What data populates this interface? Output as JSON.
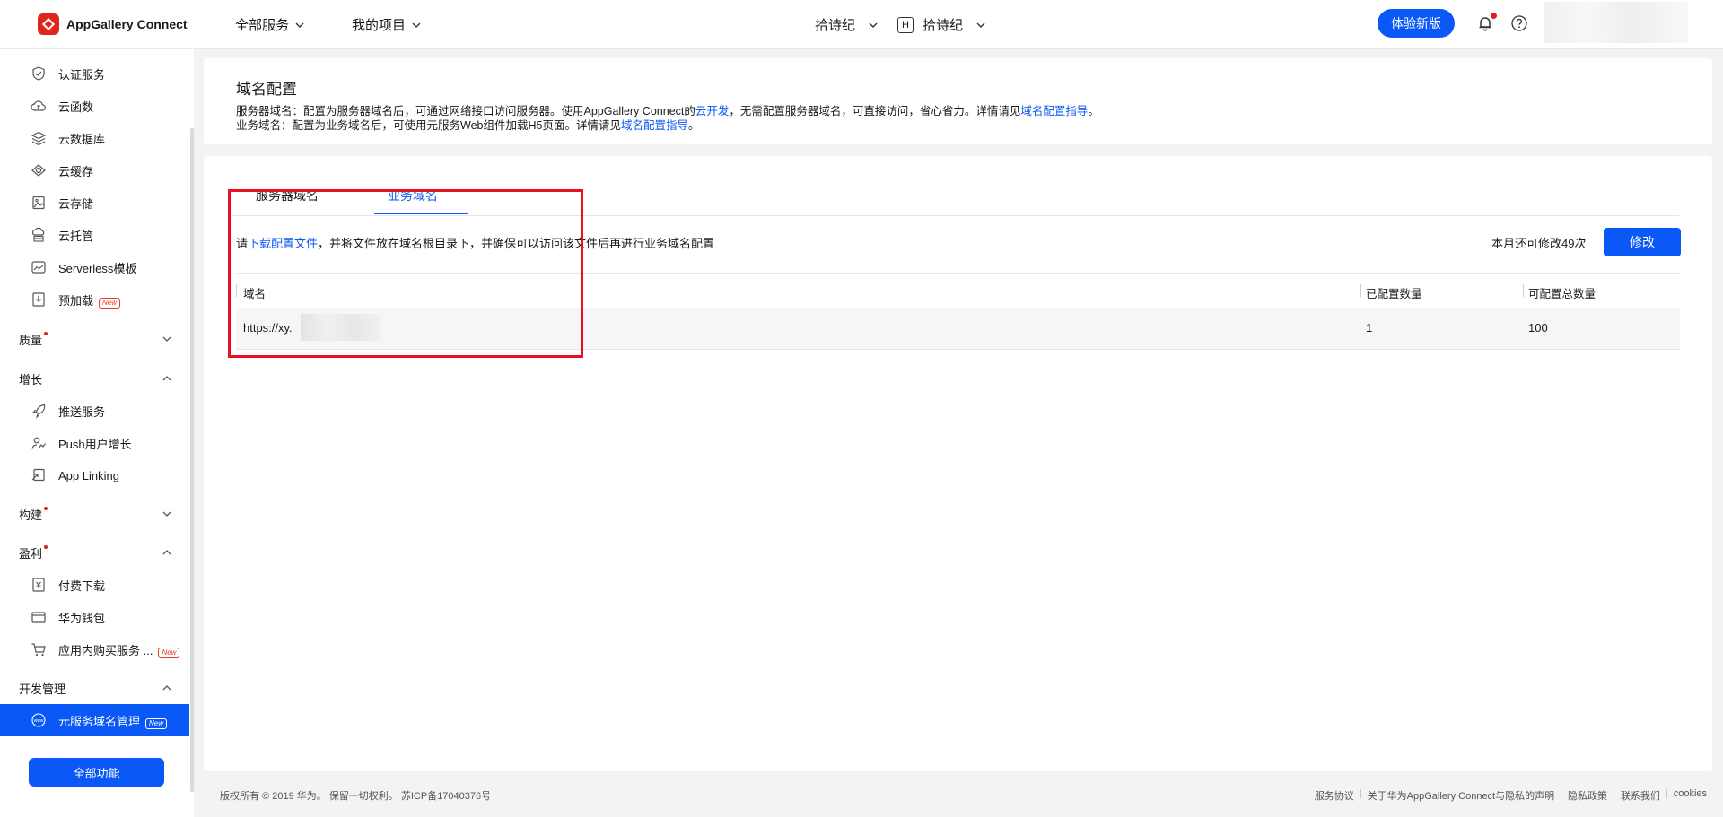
{
  "topbar": {
    "brand": "AppGallery Connect",
    "all_services": "全部服务",
    "my_projects": "我的项目",
    "project_selector": "拾诗纪",
    "app_badge": "H",
    "app_selector": "拾诗纪",
    "try_new_button": "体验新版"
  },
  "sidebar": {
    "items_top": [
      {
        "label": "认证服务",
        "icon": "shield-check-icon"
      },
      {
        "label": "云函数",
        "icon": "cloud-function-icon"
      },
      {
        "label": "云数据库",
        "icon": "database-icon"
      },
      {
        "label": "云缓存",
        "icon": "cloud-cache-icon"
      },
      {
        "label": "云存储",
        "icon": "image-storage-icon"
      },
      {
        "label": "云托管",
        "icon": "cloud-hosting-icon"
      },
      {
        "label": "Serverless模板",
        "icon": "template-icon"
      },
      {
        "label": "预加载",
        "icon": "preload-icon",
        "badge": "New"
      }
    ],
    "group_quality": "质量",
    "group_growth": "增长",
    "growth_items": [
      {
        "label": "推送服务",
        "icon": "rocket-icon"
      },
      {
        "label": "Push用户增长",
        "icon": "user-growth-icon"
      },
      {
        "label": "App Linking",
        "icon": "link-icon"
      }
    ],
    "group_build": "构建",
    "group_earn": "盈利",
    "earn_items": [
      {
        "label": "付费下载",
        "icon": "paid-download-icon"
      },
      {
        "label": "华为钱包",
        "icon": "wallet-icon"
      },
      {
        "label": "应用内购买服务 ...",
        "icon": "cart-icon",
        "badge": "New"
      }
    ],
    "group_dev": "开发管理",
    "dev_items": [
      {
        "label": "元服务域名管理",
        "icon": "www-icon",
        "badge": "New"
      }
    ],
    "all_features_button": "全部功能"
  },
  "header": {
    "title": "域名配置",
    "line1_prefix": "服务器域名：配置为服务器域名后，可通过网络接口访问服务器。使用AppGallery Connect的",
    "line1_link1": "云开发",
    "line1_middle": "，无需配置服务器域名，可直接访问，省心省力。详情请见",
    "line1_link2": "域名配置指导",
    "line1_suffix": "。",
    "line2_prefix": "业务域名：配置为业务域名后，可使用元服务Web组件加载H5页面。详情请见",
    "line2_link": "域名配置指导",
    "line2_suffix": "。"
  },
  "main": {
    "tabs": [
      "服务器域名",
      "业务域名"
    ],
    "active_tab": "业务域名",
    "notice_prefix": "请",
    "notice_link": "下载配置文件",
    "notice_suffix": "，并将文件放在域名根目录下，并确保可以访问该文件后再进行业务域名配置",
    "remaining_text": "本月还可修改49次",
    "modify_button": "修改",
    "table": {
      "columns": [
        "域名",
        "已配置数量",
        "可配置总数量"
      ],
      "rows": [
        {
          "domain": "https://xy.",
          "configured": "1",
          "total": "100"
        }
      ]
    }
  },
  "footer": {
    "copyright": "版权所有 © 2019 华为。 保留一切权利。 苏ICP备17040376号",
    "links": [
      "服务协议",
      "关于华为AppGallery Connect与隐私的声明",
      "隐私政策",
      "联系我们",
      "cookies"
    ]
  },
  "colors": {
    "primary": "#0a59f7",
    "brand_red": "#e1251b",
    "highlight_red": "#e81123"
  }
}
